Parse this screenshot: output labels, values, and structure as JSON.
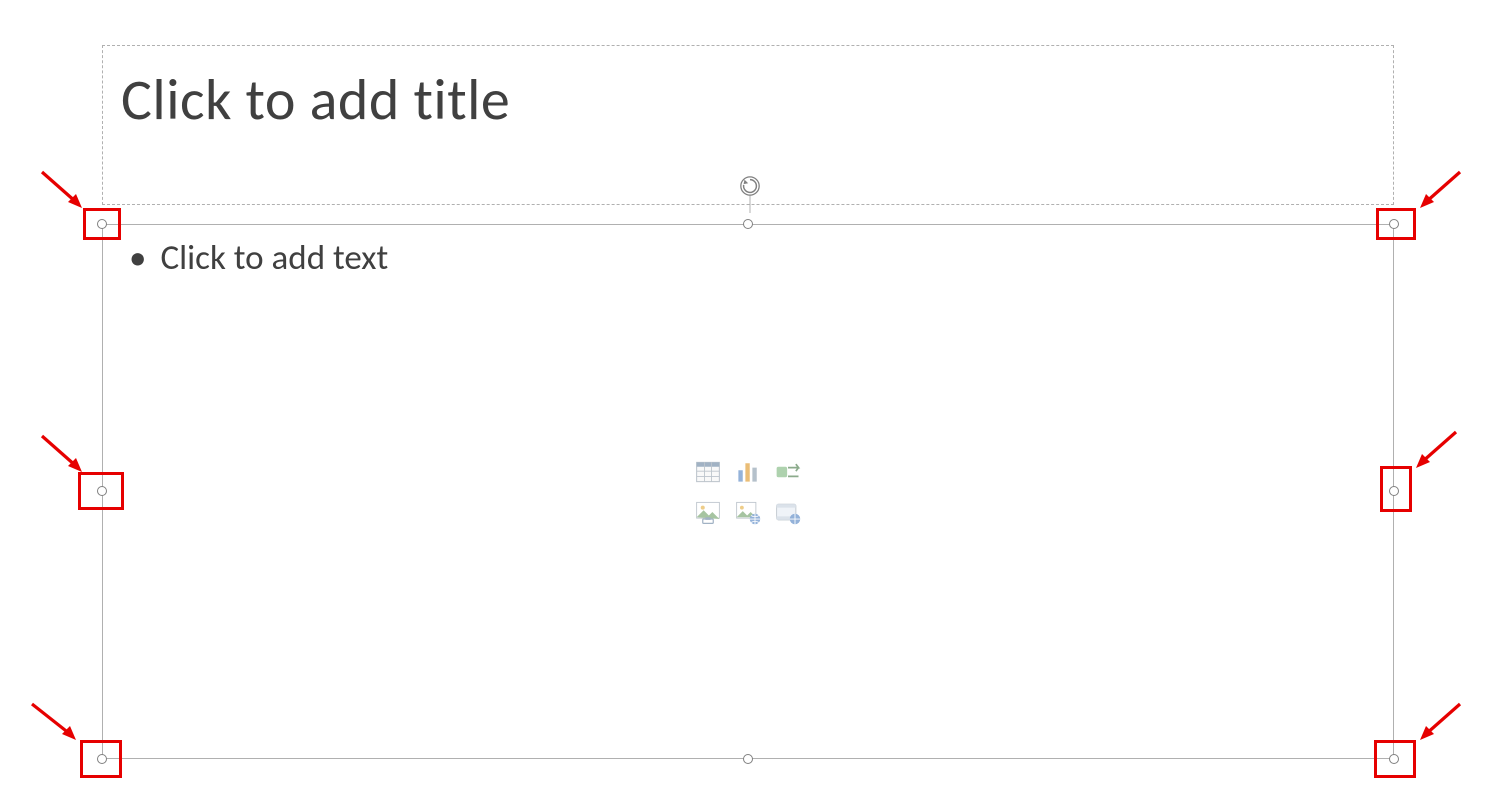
{
  "title_placeholder": "Click to add title",
  "content_placeholder": "Click to add text",
  "insert_icons": {
    "table": "insert-table-icon",
    "chart": "insert-chart-icon",
    "smartart": "insert-smartart-icon",
    "picture": "insert-picture-icon",
    "online_picture": "insert-online-picture-icon",
    "video": "insert-video-icon"
  },
  "handles": [
    "top-left",
    "top-middle",
    "top-right",
    "middle-left",
    "middle-right",
    "bottom-left",
    "bottom-middle",
    "bottom-right"
  ],
  "annotation_color": "#e60000"
}
